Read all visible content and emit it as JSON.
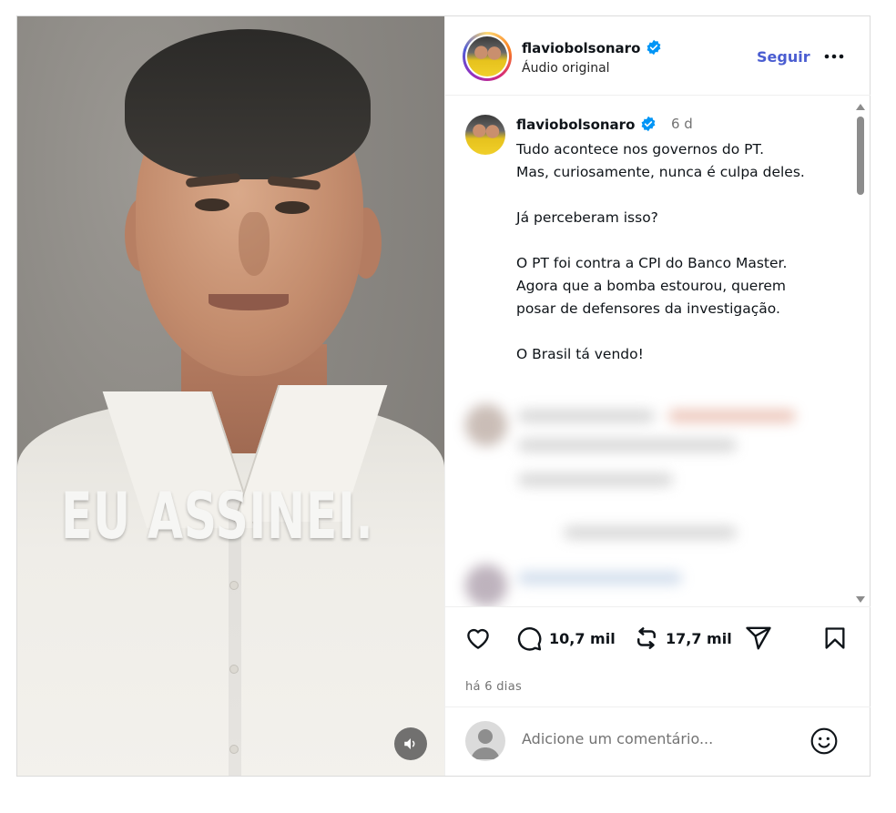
{
  "media": {
    "overlay_text": "EU ASSINEI."
  },
  "header": {
    "username": "flaviobolsonaro",
    "subtitle": "Áudio original",
    "follow_label": "Seguir"
  },
  "post": {
    "username": "flaviobolsonaro",
    "time": "6 d",
    "caption": "Tudo acontece nos governos do PT.\nMas, curiosamente, nunca é culpa deles.\n\nJá perceberam isso?\n\nO PT foi contra a CPI do Banco Master.\nAgora que a bomba estourou, querem\nposar de defensores da investigação.\n\nO Brasil tá vendo!"
  },
  "actions": {
    "comments_count": "10,7 mil",
    "reposts_count": "17,7 mil",
    "posted_ago": "há 6 dias"
  },
  "composer": {
    "placeholder": "Adicione um comentário..."
  },
  "colors": {
    "accent": "#4a5dd1",
    "verified": "#0095f6",
    "muted": "#737373"
  },
  "icons": [
    "heart-icon",
    "comment-icon",
    "repost-icon",
    "share-icon",
    "bookmark-icon",
    "emoji-icon",
    "volume-icon",
    "more-icon",
    "verified-icon"
  ]
}
